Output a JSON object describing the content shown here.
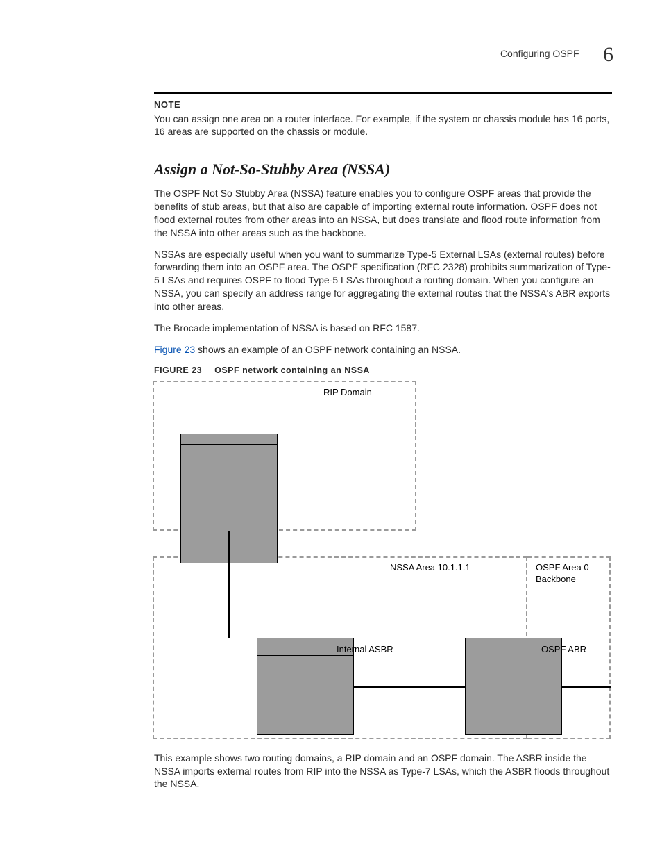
{
  "header": {
    "section_label": "Configuring OSPF",
    "chapter_number": "6"
  },
  "note": {
    "label": "NOTE",
    "text": "You can assign one area on a router interface. For example, if the system or chassis module has 16 ports, 16 areas are supported on the chassis or module."
  },
  "section_title": "Assign a Not-So-Stubby Area (NSSA)",
  "paragraphs": {
    "p1": "The OSPF Not So Stubby Area (NSSA) feature enables you to configure OSPF areas that provide the benefits of stub areas, but that also are capable of importing external route information. OSPF does not flood external routes from other areas into an NSSA, but does translate and flood route information from the NSSA into other areas such as the backbone.",
    "p2": "NSSAs are especially useful when you want to summarize Type-5 External LSAs (external routes) before forwarding them into an OSPF area. The OSPF specification (RFC 2328) prohibits summarization of Type-5 LSAs and requires OSPF to flood Type-5 LSAs throughout a routing domain. When you configure an NSSA, you can specify an address range for aggregating the external routes that the NSSA's ABR exports into other areas.",
    "p3": "The Brocade implementation of NSSA is based on RFC 1587.",
    "p4_link": "Figure 23",
    "p4_rest": " shows an example of an OSPF network containing an NSSA."
  },
  "figure": {
    "label": "FIGURE 23",
    "caption": "OSPF network containing an NSSA",
    "labels": {
      "rip_domain": "RIP Domain",
      "nssa_area": "NSSA Area 10.1.1.1",
      "backbone": "OSPF Area 0\nBackbone",
      "internal_asbr": "Internal ASBR",
      "ospf_abr": "OSPF ABR"
    }
  },
  "closing": "This example shows two routing domains, a RIP domain and an OSPF domain. The ASBR inside the NSSA imports external routes from RIP into the NSSA as Type-7 LSAs, which the ASBR floods throughout the NSSA."
}
